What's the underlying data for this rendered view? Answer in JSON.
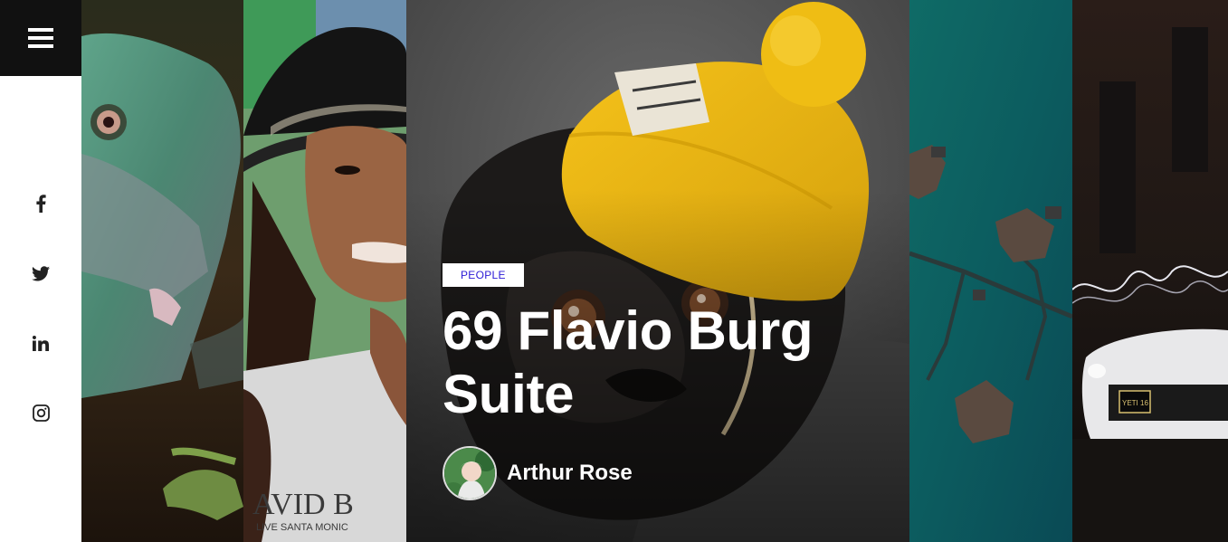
{
  "sidebar": {
    "menu_icon": "hamburger-icon",
    "social": [
      {
        "icon": "facebook-icon"
      },
      {
        "icon": "twitter-icon"
      },
      {
        "icon": "linkedin-icon"
      },
      {
        "icon": "instagram-icon"
      }
    ]
  },
  "panels": [
    {
      "subject": "iguana"
    },
    {
      "subject": "woman-in-hat"
    },
    {
      "subject": "pug-in-yellow-beanie",
      "featured": true
    },
    {
      "subject": "aerial-water-bungalows"
    },
    {
      "subject": "white-car-light-painting"
    }
  ],
  "featured": {
    "category": "PEOPLE",
    "title": "69 Flavio Burg Suite",
    "author": "Arthur Rose"
  },
  "colors": {
    "menu_bg": "#111111",
    "badge_text": "#2b1ad6",
    "title_text": "#ffffff"
  }
}
